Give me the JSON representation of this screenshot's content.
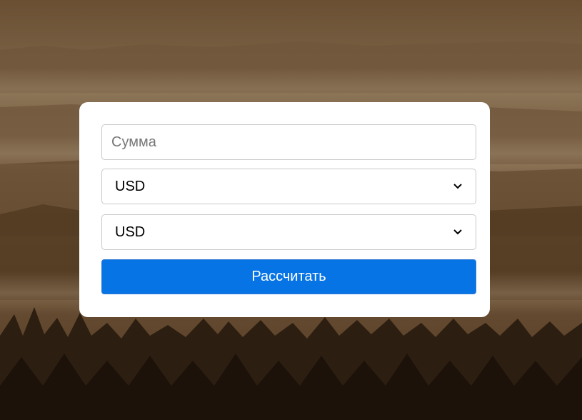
{
  "form": {
    "amount_placeholder": "Сумма",
    "amount_value": "",
    "from_currency": "USD",
    "to_currency": "USD",
    "submit_label": "Рассчитать"
  },
  "colors": {
    "button": "#0774e6",
    "card": "#ffffff",
    "background": "#6b5034"
  },
  "icons": {
    "select_arrow": "chevron-down-icon"
  }
}
